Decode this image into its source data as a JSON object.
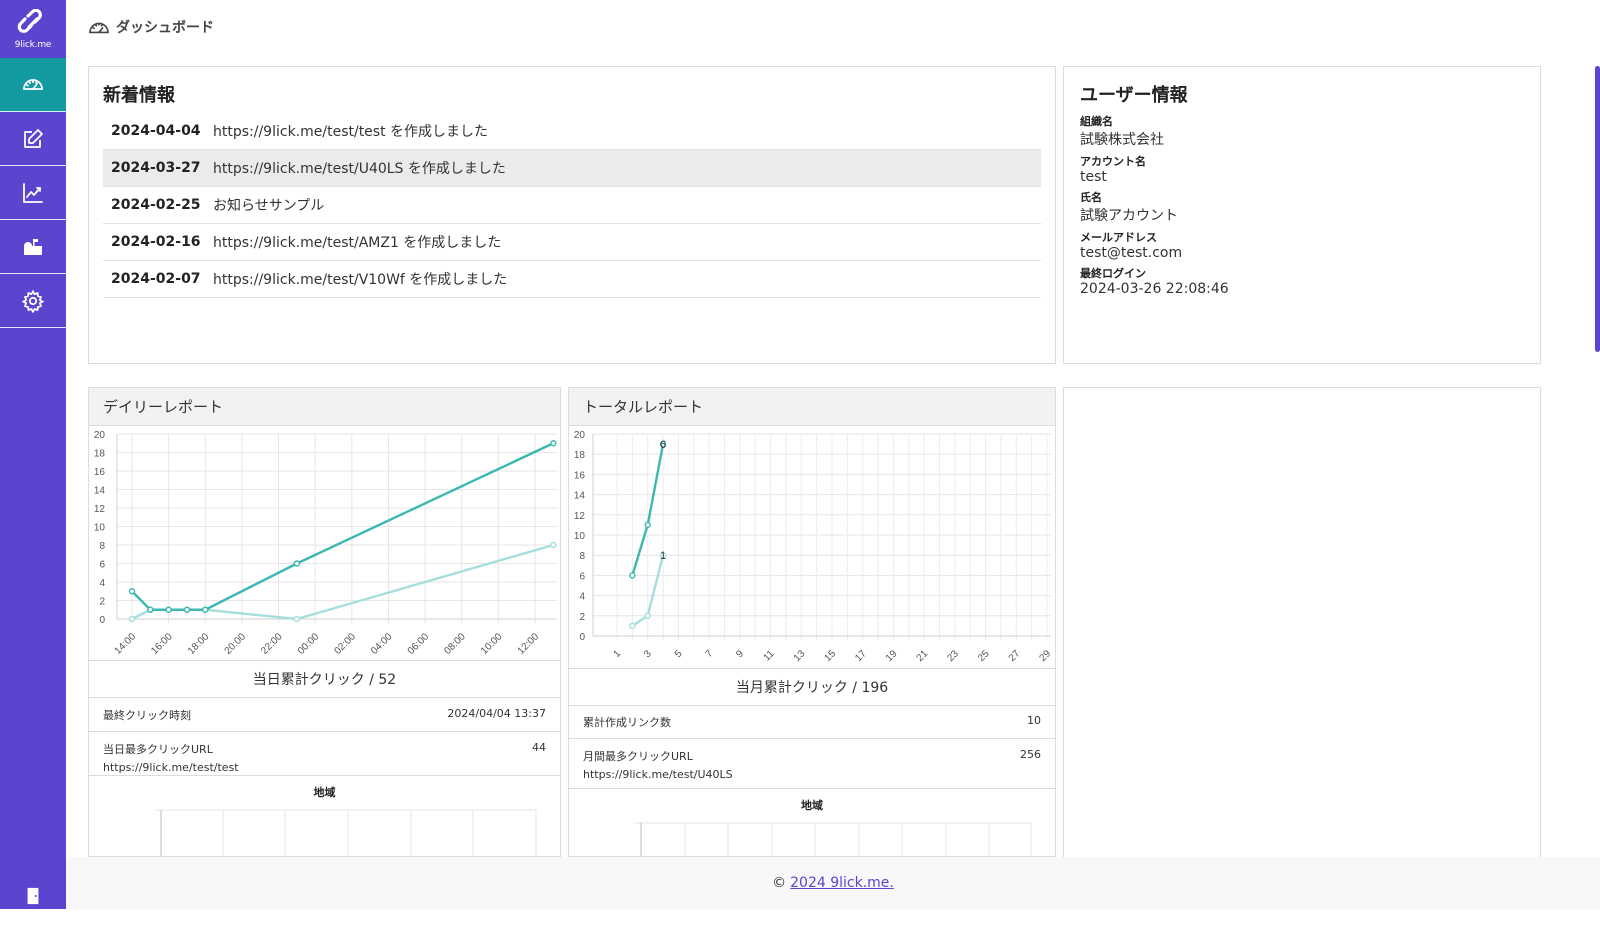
{
  "app": {
    "logo_text": "9lick.me"
  },
  "breadcrumb": {
    "title": "ダッシュボード"
  },
  "sidebar": {
    "items": [
      {
        "icon": "dashboard-icon",
        "active": true
      },
      {
        "icon": "edit-icon",
        "active": false
      },
      {
        "icon": "chart-icon",
        "active": false
      },
      {
        "icon": "mailbox-icon",
        "active": false
      },
      {
        "icon": "gear-icon",
        "active": false
      }
    ],
    "logout_icon": "door-icon"
  },
  "news": {
    "title": "新着情報",
    "items": [
      {
        "date": "2024-04-04",
        "text": "https://9lick.me/test/test を作成しました"
      },
      {
        "date": "2024-03-27",
        "text": "https://9lick.me/test/U40LS を作成しました"
      },
      {
        "date": "2024-02-25",
        "text": "お知らせサンプル"
      },
      {
        "date": "2024-02-16",
        "text": "https://9lick.me/test/AMZ1 を作成しました"
      },
      {
        "date": "2024-02-07",
        "text": "https://9lick.me/test/V10Wf を作成しました"
      }
    ]
  },
  "user": {
    "title": "ユーザー情報",
    "fields": [
      {
        "label": "組織名",
        "value": "試験株式会社"
      },
      {
        "label": "アカウント名",
        "value": "test"
      },
      {
        "label": "氏名",
        "value": "試験アカウント"
      },
      {
        "label": "メールアドレス",
        "value": "test@test.com"
      },
      {
        "label": "最終ログイン",
        "value": "2024-03-26 22:08:46"
      }
    ]
  },
  "daily": {
    "title": "デイリーレポート",
    "summary": "当日累計クリック / 52",
    "last_click_label": "最終クリック時刻",
    "last_click_value": "2024/04/04 13:37",
    "top_url_label": "当日最多クリックURL",
    "top_url_count": "44",
    "top_url": "https://9lick.me/test/test",
    "region_label": "地域"
  },
  "total": {
    "title": "トータルレポート",
    "summary": "当月累計クリック / 196",
    "links_label": "累計作成リンク数",
    "links_value": "10",
    "top_url_label": "月間最多クリックURL",
    "top_url_count": "256",
    "top_url": "https://9lick.me/test/U40LS",
    "region_label": "地域"
  },
  "footer": {
    "prefix": "©",
    "link": "2024 9lick.me."
  },
  "colors": {
    "sidebar": "#5b45cf",
    "active": "#139aa0",
    "series_dark": "#3bb8b0",
    "series_light": "#a6dedb"
  },
  "chart_data": [
    {
      "type": "line",
      "x": [
        "14:00",
        "15:00",
        "16:00",
        "17:00",
        "18:00",
        "23:00",
        "13:00"
      ],
      "x_ticks": [
        "14:00",
        "16:00",
        "18:00",
        "20:00",
        "22:00",
        "00:00",
        "02:00",
        "04:00",
        "06:00",
        "08:00",
        "10:00",
        "12:00"
      ],
      "series": [
        {
          "values": [
            3,
            1,
            1,
            1,
            1,
            6,
            19
          ]
        },
        {
          "values": [
            0,
            1,
            1,
            1,
            1,
            0,
            8
          ]
        }
      ],
      "ylim": [
        0,
        20
      ],
      "y_ticks": [
        0,
        2,
        4,
        6,
        8,
        10,
        12,
        14,
        16,
        18,
        20
      ],
      "grid": true
    },
    {
      "type": "line",
      "x": [
        2,
        3,
        4
      ],
      "x_ticks": [
        "1",
        "3",
        "5",
        "7",
        "9",
        "11",
        "13",
        "15",
        "17",
        "19",
        "21",
        "23",
        "25",
        "27",
        "29"
      ],
      "series": [
        {
          "values": [
            6,
            11,
            19
          ],
          "end_label": "6"
        },
        {
          "values": [
            1,
            2,
            8
          ],
          "end_label": "1"
        }
      ],
      "ylim": [
        0,
        20
      ],
      "y_ticks": [
        0,
        2,
        4,
        6,
        8,
        10,
        12,
        14,
        16,
        18,
        20
      ],
      "grid": true
    }
  ]
}
